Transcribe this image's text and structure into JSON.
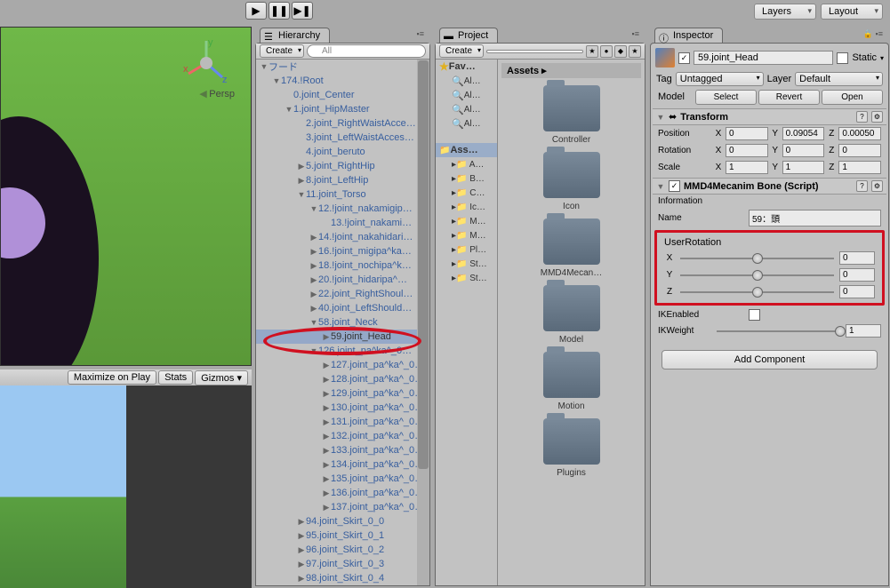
{
  "toolbar": {
    "layers": "Layers",
    "layout": "Layout"
  },
  "hierarchy": {
    "tab": "Hierarchy",
    "create": "Create",
    "search_placeholder": "All",
    "items": [
      {
        "indent": 0,
        "d": "▼",
        "label": "フード"
      },
      {
        "indent": 1,
        "d": "▼",
        "label": "174.!Root"
      },
      {
        "indent": 2,
        "d": "",
        "label": "0.joint_Center"
      },
      {
        "indent": 2,
        "d": "▼",
        "label": "1.joint_HipMaster"
      },
      {
        "indent": 3,
        "d": "",
        "label": "2.joint_RightWaistAcce…"
      },
      {
        "indent": 3,
        "d": "",
        "label": "3.joint_LeftWaistAcces…"
      },
      {
        "indent": 3,
        "d": "",
        "label": "4.joint_beruto"
      },
      {
        "indent": 3,
        "d": "▶",
        "label": "5.joint_RightHip"
      },
      {
        "indent": 3,
        "d": "▶",
        "label": "8.joint_LeftHip"
      },
      {
        "indent": 3,
        "d": "▼",
        "label": "11.joint_Torso"
      },
      {
        "indent": 4,
        "d": "▼",
        "label": "12.!joint_nakamigip…"
      },
      {
        "indent": 5,
        "d": "",
        "label": "13.!joint_nakami…"
      },
      {
        "indent": 4,
        "d": "▶",
        "label": "14.!joint_nakahidari…"
      },
      {
        "indent": 4,
        "d": "▶",
        "label": "16.!joint_migipa^ka…"
      },
      {
        "indent": 4,
        "d": "▶",
        "label": "18.!joint_nochipa^k…"
      },
      {
        "indent": 4,
        "d": "▶",
        "label": "20.!joint_hidaripa^…"
      },
      {
        "indent": 4,
        "d": "▶",
        "label": "22.joint_RightShoul…"
      },
      {
        "indent": 4,
        "d": "▶",
        "label": "40.joint_LeftShould…"
      },
      {
        "indent": 4,
        "d": "▼",
        "label": "58.joint_Neck"
      },
      {
        "indent": 5,
        "d": "▶",
        "label": "59.joint_Head",
        "sel": true
      },
      {
        "indent": 4,
        "d": "▼",
        "label": "126.joint_pa^ka^_0…"
      },
      {
        "indent": 5,
        "d": "▶",
        "label": "127.joint_pa^ka^_0…"
      },
      {
        "indent": 5,
        "d": "▶",
        "label": "128.joint_pa^ka^_0…"
      },
      {
        "indent": 5,
        "d": "▶",
        "label": "129.joint_pa^ka^_0…"
      },
      {
        "indent": 5,
        "d": "▶",
        "label": "130.joint_pa^ka^_0…"
      },
      {
        "indent": 5,
        "d": "▶",
        "label": "131.joint_pa^ka^_0…"
      },
      {
        "indent": 5,
        "d": "▶",
        "label": "132.joint_pa^ka^_0…"
      },
      {
        "indent": 5,
        "d": "▶",
        "label": "133.joint_pa^ka^_0…"
      },
      {
        "indent": 5,
        "d": "▶",
        "label": "134.joint_pa^ka^_0…"
      },
      {
        "indent": 5,
        "d": "▶",
        "label": "135.joint_pa^ka^_0…"
      },
      {
        "indent": 5,
        "d": "▶",
        "label": "136.joint_pa^ka^_0…"
      },
      {
        "indent": 5,
        "d": "▶",
        "label": "137.joint_pa^ka^_0…"
      },
      {
        "indent": 3,
        "d": "▶",
        "label": "94.joint_Skirt_0_0"
      },
      {
        "indent": 3,
        "d": "▶",
        "label": "95.joint_Skirt_0_1"
      },
      {
        "indent": 3,
        "d": "▶",
        "label": "96.joint_Skirt_0_2"
      },
      {
        "indent": 3,
        "d": "▶",
        "label": "97.joint_Skirt_0_3"
      },
      {
        "indent": 3,
        "d": "▶",
        "label": "98.joint_Skirt_0_4"
      }
    ]
  },
  "project": {
    "tab": "Project",
    "create": "Create",
    "favorites": "Fav…",
    "fav_items": [
      "Al…",
      "Al…",
      "Al…",
      "Al…"
    ],
    "assets_header": "Ass…",
    "tree_items": [
      "A…",
      "B…",
      "C…",
      "Ic…",
      "M…",
      "M…",
      "Pl…",
      "St…",
      "St…"
    ],
    "breadcrumb": "Assets ▸",
    "folders": [
      "Controller",
      "Icon",
      "MMD4Mecan…",
      "Model",
      "Motion",
      "Plugins"
    ]
  },
  "inspector": {
    "tab": "Inspector",
    "static_label": "Static",
    "object_name": "59.joint_Head",
    "tag_label": "Tag",
    "tag_value": "Untagged",
    "layer_label": "Layer",
    "layer_value": "Default",
    "model_label": "Model",
    "select_btn": "Select",
    "revert_btn": "Revert",
    "open_btn": "Open",
    "transform": {
      "title": "Transform",
      "position": "Position",
      "rotation": "Rotation",
      "scale": "Scale",
      "pos": {
        "x": "0",
        "y": "0.09054",
        "z": "0.00050"
      },
      "rot": {
        "x": "0",
        "y": "0",
        "z": "0"
      },
      "scl": {
        "x": "1",
        "y": "1",
        "z": "1"
      }
    },
    "bone": {
      "title": "MMD4Mecanim Bone (Script)",
      "info_label": "Information",
      "name_label": "Name",
      "name_value": "59：頭",
      "user_rotation": "UserRotation",
      "x_val": "0",
      "y_val": "0",
      "z_val": "0",
      "ik_enabled": "IKEnabled",
      "ik_weight": "IKWeight",
      "ik_weight_val": "1"
    },
    "add_component": "Add Component"
  },
  "scene": {
    "persp": "Persp",
    "maximize": "Maximize on Play",
    "stats": "Stats",
    "gizmos": "Gizmos"
  }
}
